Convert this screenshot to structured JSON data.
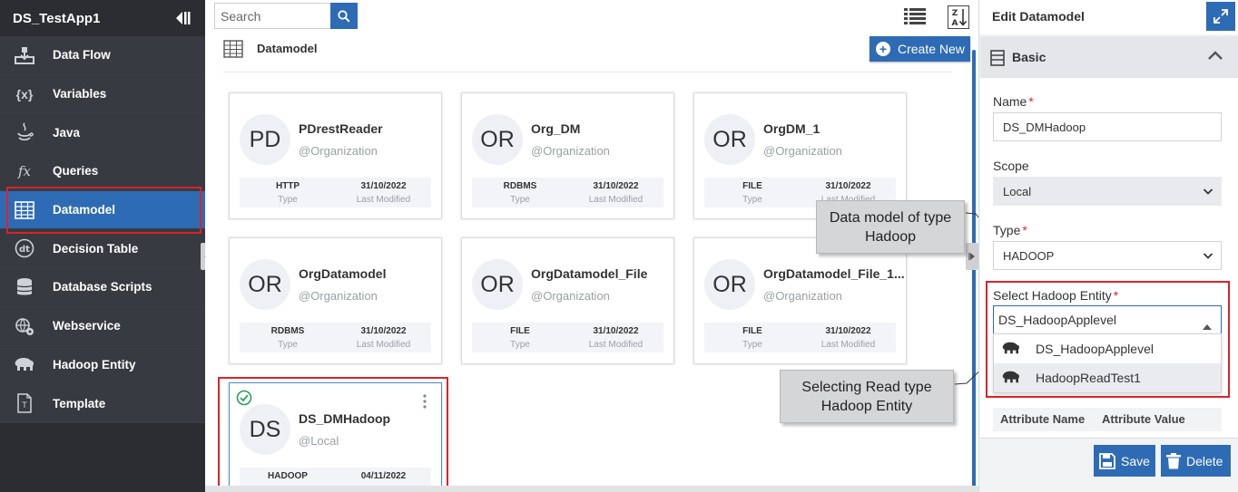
{
  "app": {
    "title": "DS_TestApp1"
  },
  "sidebar": {
    "items": [
      {
        "label": "Data Flow",
        "icon": "data-flow-icon",
        "active": false
      },
      {
        "label": "Variables",
        "icon": "variables-icon",
        "active": false
      },
      {
        "label": "Java",
        "icon": "java-icon",
        "active": false
      },
      {
        "label": "Queries",
        "icon": "queries-icon",
        "active": false
      },
      {
        "label": "Datamodel",
        "icon": "datamodel-icon",
        "active": true
      },
      {
        "label": "Decision Table",
        "icon": "decision-table-icon",
        "active": false
      },
      {
        "label": "Database Scripts",
        "icon": "database-icon",
        "active": false
      },
      {
        "label": "Webservice",
        "icon": "webservice-icon",
        "active": false
      },
      {
        "label": "Hadoop Entity",
        "icon": "hadoop-icon",
        "active": false
      },
      {
        "label": "Template",
        "icon": "template-icon",
        "active": false
      }
    ]
  },
  "search": {
    "placeholder": "Search",
    "value": ""
  },
  "main": {
    "section_title": "Datamodel",
    "create_label": "Create New",
    "type_label": "Type",
    "modified_label": "Last Modified",
    "cards": [
      {
        "initials": "PD",
        "name": "PDrestReader",
        "org": "@Organization",
        "type": "HTTP",
        "date": "31/10/2022"
      },
      {
        "initials": "OR",
        "name": "Org_DM",
        "org": "@Organization",
        "type": "RDBMS",
        "date": "31/10/2022"
      },
      {
        "initials": "OR",
        "name": "OrgDM_1",
        "org": "@Organization",
        "type": "FILE",
        "date": "31/10/2022"
      },
      {
        "initials": "OR",
        "name": "OrgDatamodel",
        "org": "@Organization",
        "type": "RDBMS",
        "date": "31/10/2022"
      },
      {
        "initials": "OR",
        "name": "OrgDatamodel_File",
        "org": "@Organization",
        "type": "FILE",
        "date": "31/10/2022"
      },
      {
        "initials": "OR",
        "name": "OrgDatamodel_File_1...",
        "org": "@Organization",
        "type": "FILE",
        "date": "31/10/2022"
      },
      {
        "initials": "DS",
        "name": "DS_DMHadoop",
        "org": "@Local",
        "type": "HADOOP",
        "date": "04/11/2022",
        "selected": true
      }
    ]
  },
  "callouts": {
    "type_hadoop": "Data model of type Hadoop",
    "read_type": "Selecting Read type Hadoop Entity"
  },
  "panel": {
    "title": "Edit Datamodel",
    "section": "Basic",
    "name_label": "Name",
    "name_value": "DS_DMHadoop",
    "scope_label": "Scope",
    "scope_value": "Local",
    "type_label": "Type",
    "type_value": "HADOOP",
    "entity_label": "Select Hadoop Entity",
    "entity_value": "DS_HadoopApplevel",
    "entity_options": [
      "DS_HadoopApplevel",
      "HadoopReadTest1"
    ],
    "attr_name_header": "Attribute Name",
    "attr_value_header": "Attribute Value",
    "save_label": "Save",
    "delete_label": "Delete"
  },
  "colors": {
    "accent": "#2e6bb5",
    "sidebar_bg": "#2b2d33",
    "highlight": "#d9232b",
    "success": "#2a9d5b"
  }
}
